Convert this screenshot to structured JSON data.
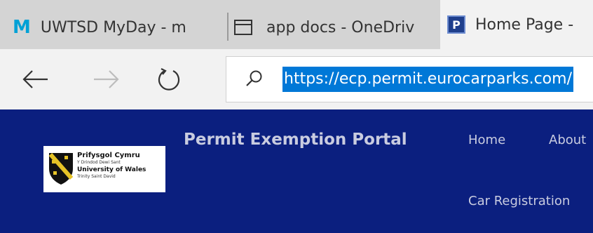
{
  "tabs": [
    {
      "icon": "myday-m-icon",
      "glyph": "M",
      "label": "UWTSD MyDay - m"
    },
    {
      "icon": "window-tab-icon",
      "label": "app docs - OneDriv"
    },
    {
      "icon": "permit-p-icon",
      "glyph": "P",
      "label": "Home Page -"
    }
  ],
  "address": {
    "url": "https://ecp.permit.eurocarparks.com/"
  },
  "site": {
    "logo": {
      "line1": "Prifysgol Cymru",
      "line2": "Y Drindod Dewi Sant",
      "line3": "University of Wales",
      "line4": "Trinity Saint David"
    },
    "title": "Permit Exemption Portal",
    "nav": [
      "Home",
      "About",
      "Car Registration"
    ]
  },
  "colors": {
    "site_background": "#0b1f7f",
    "url_highlight": "#0078d7",
    "tabstrip": "#d4d4d4"
  }
}
